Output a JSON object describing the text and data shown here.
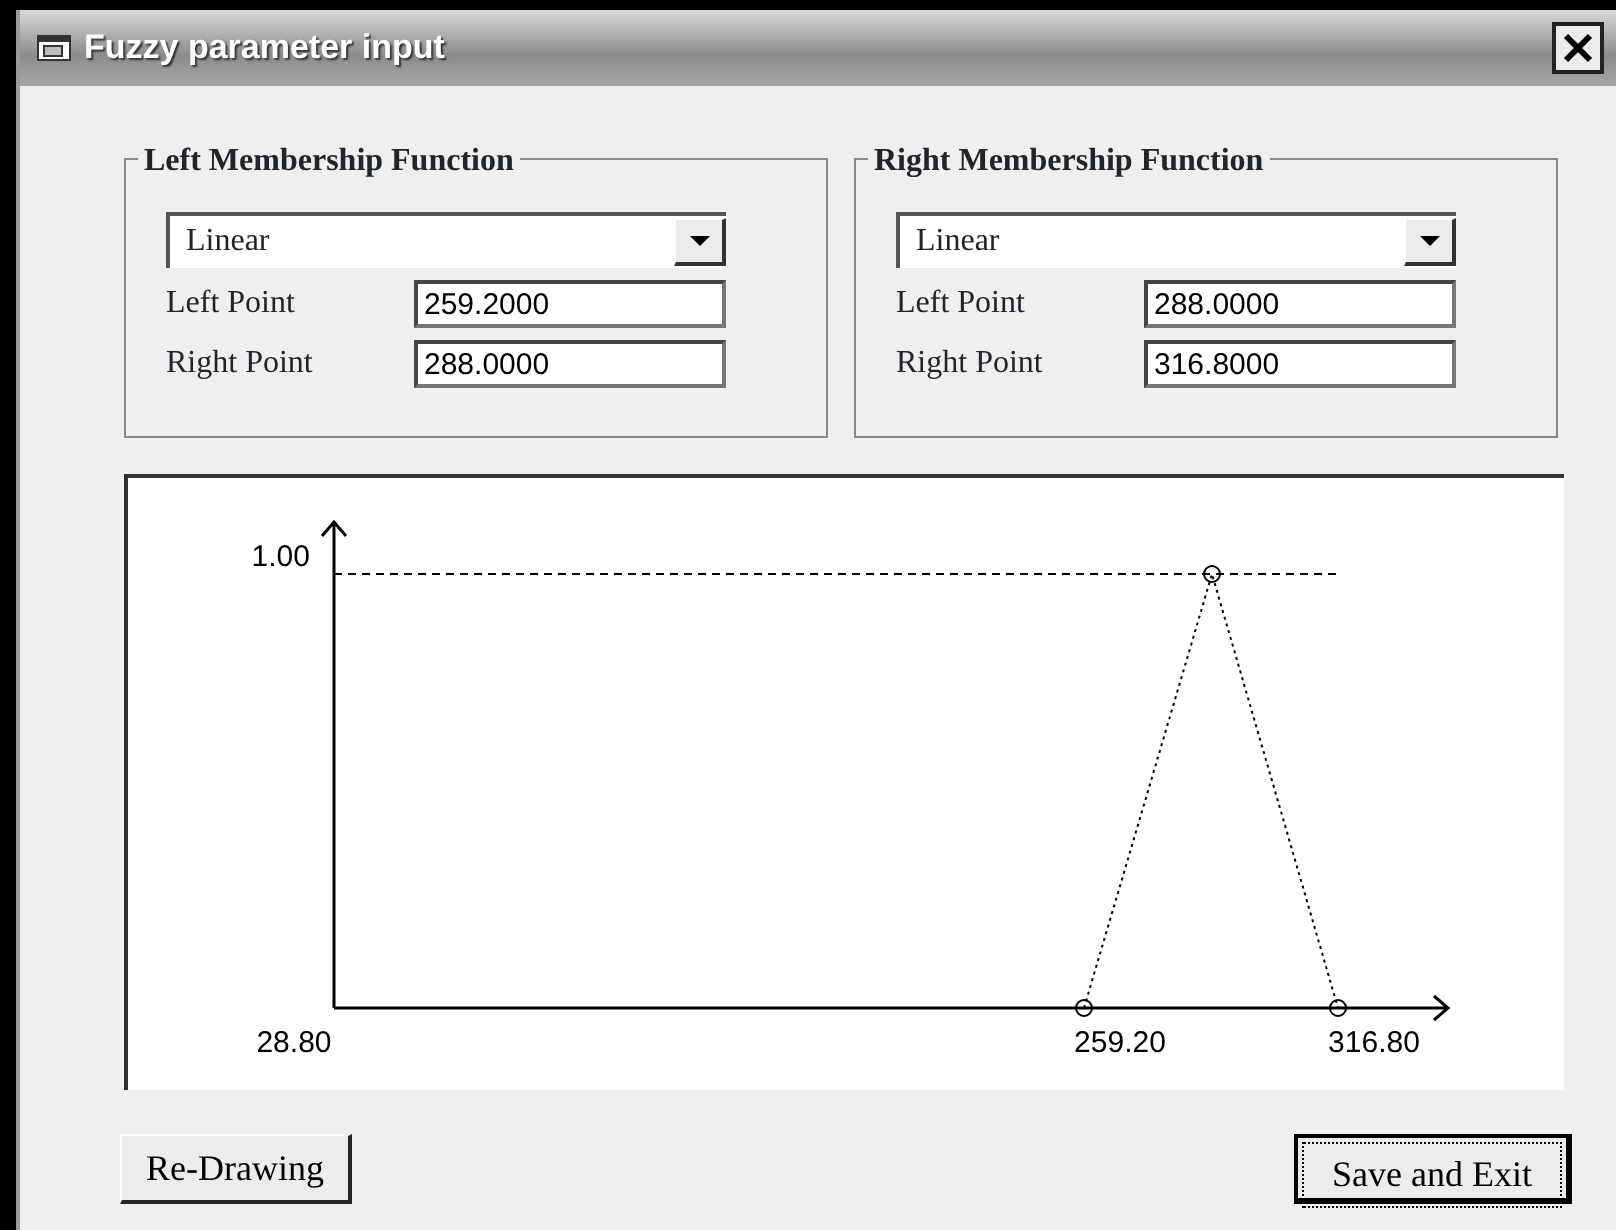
{
  "window": {
    "title": "Fuzzy parameter input"
  },
  "groups": [
    {
      "title": "Left Membership Function",
      "function_type": "Linear",
      "fields": [
        {
          "label": "Left Point",
          "value": "259.2000"
        },
        {
          "label": "Right Point",
          "value": "288.0000"
        }
      ]
    },
    {
      "title": "Right Membership Function",
      "function_type": "Linear",
      "fields": [
        {
          "label": "Left Point",
          "value": "288.0000"
        },
        {
          "label": "Right Point",
          "value": "316.8000"
        }
      ]
    }
  ],
  "plot": {
    "y_label": "1.00",
    "x_labels": [
      "28.80",
      "259.20",
      "316.80"
    ]
  },
  "buttons": [
    {
      "label": "Re-Drawing",
      "focused": false
    },
    {
      "label": "Save and Exit",
      "focused": true
    }
  ]
}
